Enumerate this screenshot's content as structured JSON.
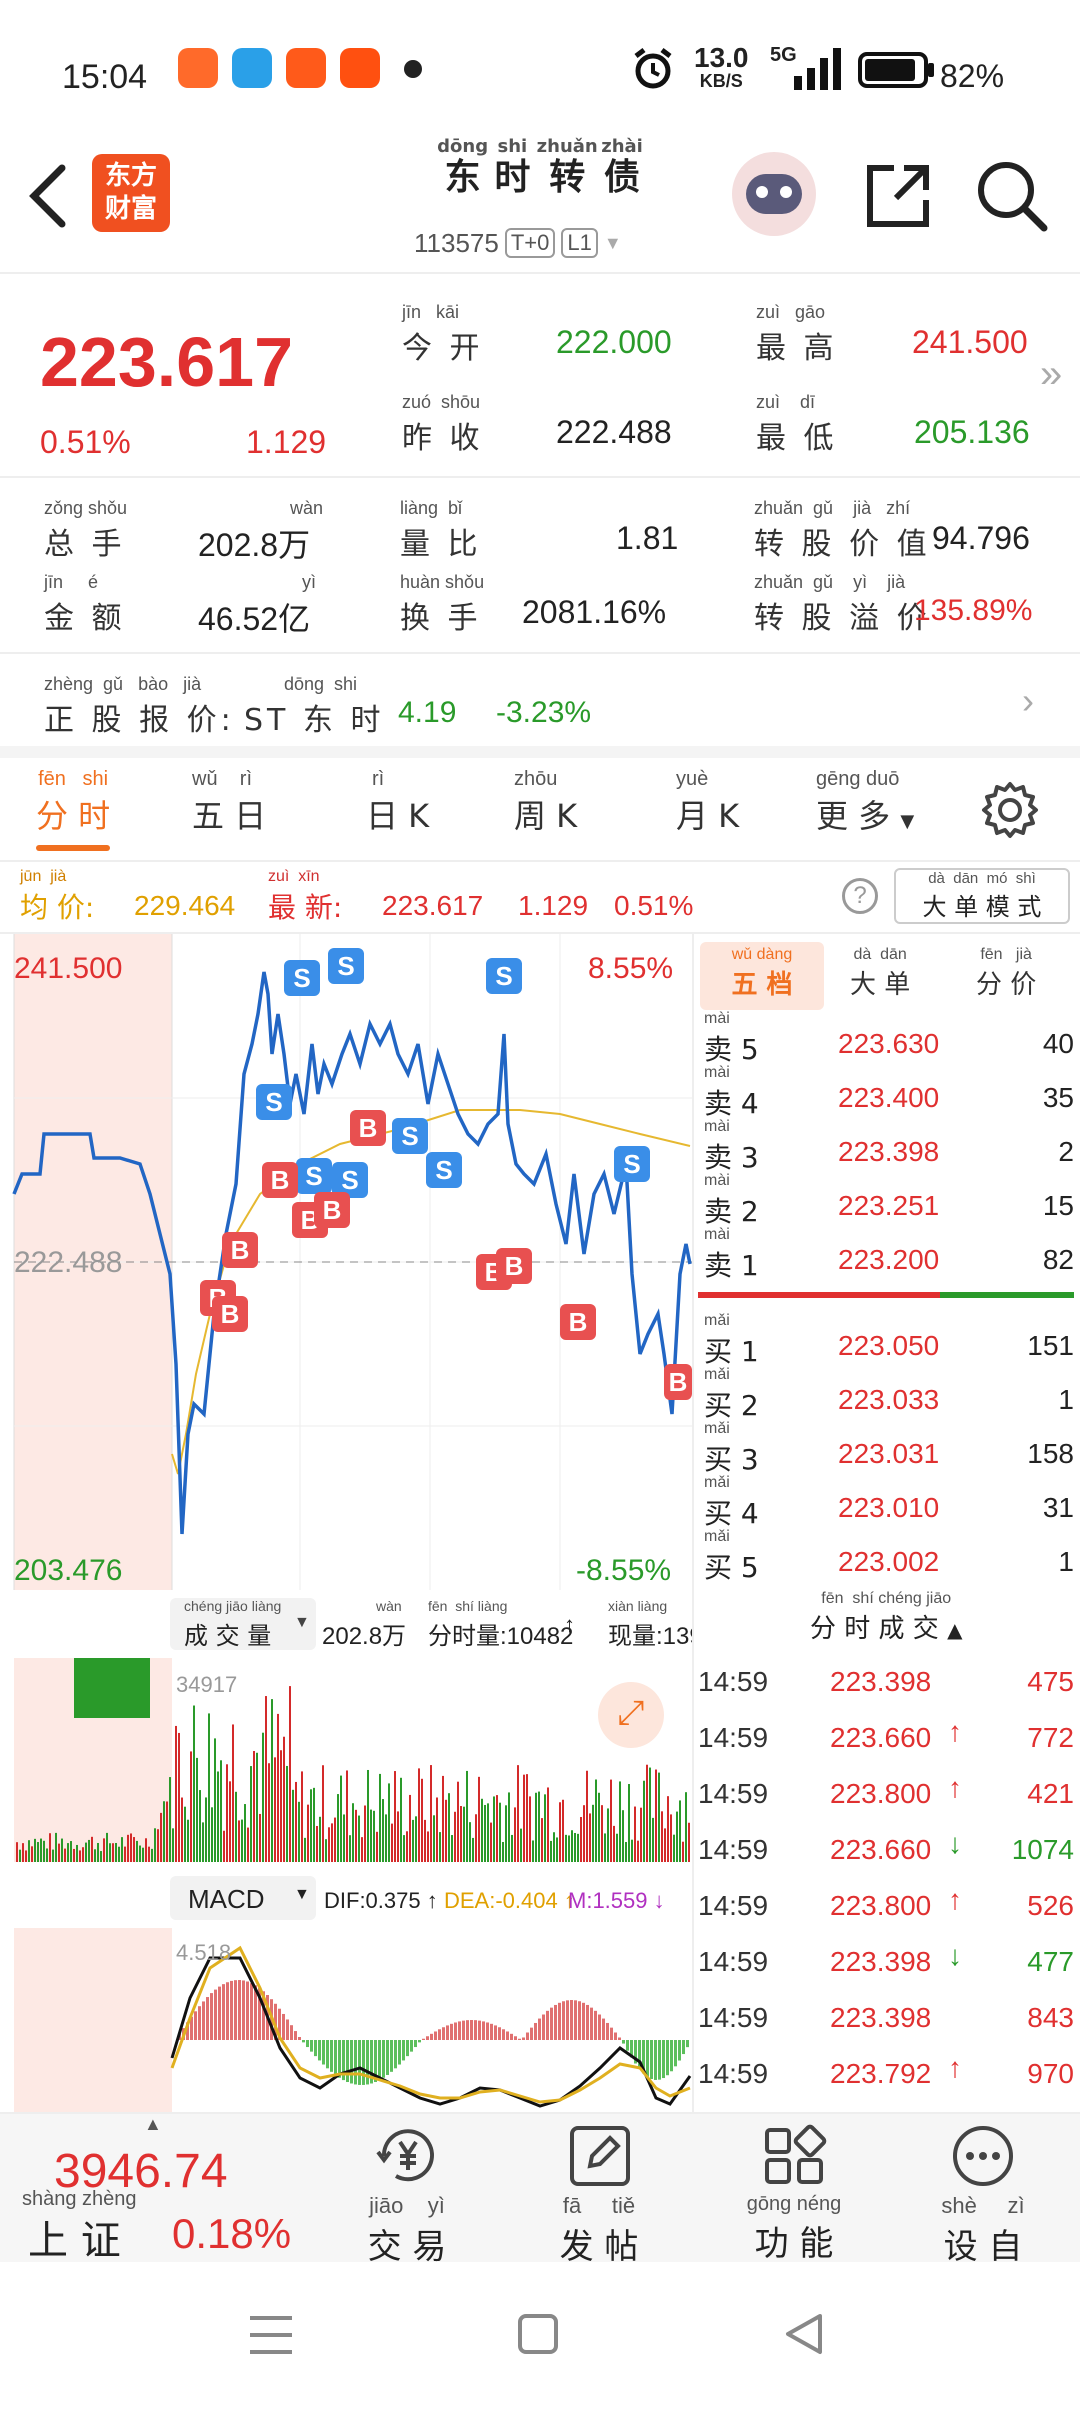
{
  "status_bar": {
    "time": "15:04",
    "speed": "13.0",
    "speed_unit": "KB/S",
    "net": "5G",
    "battery": "82%"
  },
  "header": {
    "logo_line1": "东方",
    "logo_line2": "财富",
    "title_chars": [
      {
        "c": "东",
        "py": "dōng"
      },
      {
        "c": "时",
        "py": "shi"
      },
      {
        "c": "转",
        "py": "zhuǎn"
      },
      {
        "c": "债",
        "py": "zhài"
      }
    ],
    "code": "113575",
    "tag1": "T+0",
    "tag2": "L1"
  },
  "quote": {
    "price": "223.617",
    "change_pct": "0.51%",
    "change": "1.129",
    "open_label": "今 开",
    "open_py": "jīn   kāi",
    "open": "222.000",
    "prev_label": "昨 收",
    "prev_py": "zuó  shōu",
    "prev": "222.488",
    "high_label": "最 高",
    "high_py": "zuì   gāo",
    "high": "241.500",
    "low_label": "最 低",
    "low_py": "zuì    dī",
    "low": "205.136"
  },
  "stats": {
    "vol_label": "总 手",
    "vol_py": "zǒng shǒu",
    "vol": "202.8万",
    "vol_unit_py": "wàn",
    "ratio_label": "量 比",
    "ratio_py": "liàng  bǐ",
    "ratio": "1.81",
    "conv_label": "转 股 价 值",
    "conv_py": "zhuǎn  gǔ    jià   zhí",
    "conv": "94.796",
    "amt_label": "金 额",
    "amt_py": "jīn     é",
    "amt": "46.52亿",
    "amt_unit_py": "yì",
    "turn_label": "换 手",
    "turn_py": "huàn shǒu",
    "turn": "2081.16%",
    "prem_label": "转 股 溢 价",
    "prem_py": "zhuǎn  gǔ    yì    jià",
    "prem": "135.89%"
  },
  "stock_row": {
    "label": "正 股 报 价:",
    "label_py": "zhèng  gǔ   bào   jià",
    "name": "ST 东 时",
    "name_py": "dōng  shi",
    "price": "4.19",
    "pct": "-3.23%"
  },
  "tabs": [
    {
      "label": "分 时",
      "py": "fēn   shi",
      "active": true
    },
    {
      "label": "五 日",
      "py": "wǔ    rì",
      "active": false
    },
    {
      "label": "日 K",
      "py": "rì",
      "active": false
    },
    {
      "label": "周 K",
      "py": "zhōu",
      "active": false
    },
    {
      "label": "月 K",
      "py": "yuè",
      "active": false
    },
    {
      "label": "更 多",
      "py": "gēng duō",
      "active": false
    }
  ],
  "avg_row": {
    "avg_label": "均 价:",
    "avg_py": "jūn  jià",
    "avg": "229.464",
    "new_label": "最 新:",
    "new_py": "zuì  xīn",
    "new": "223.617",
    "chg": "1.129",
    "pct": "0.51%",
    "mode": "大 单 模 式",
    "mode_py": "dà  dān  mó  shì"
  },
  "chart_labels": {
    "top_left": "241.500",
    "top_right": "8.55%",
    "mid_left": "222.488",
    "bot_left": "203.476",
    "bot_right": "-8.55%"
  },
  "vol_bar": {
    "label": "成 交 量",
    "label_py": "chéng jiāo liàng",
    "total": "202.8万",
    "total_py": "wàn",
    "minute": "分时量:10482",
    "minute_py": "fēn  shí liàng",
    "now": "现量:139",
    "now_py": "xiàn liàng",
    "max": "34917"
  },
  "macd_bar": {
    "label": "MACD",
    "dif": "DIF:0.375",
    "dea": "DEA:-0.404",
    "m": "M:1.559",
    "max": "4.518"
  },
  "book": {
    "tabs": [
      {
        "label": "五 档",
        "py": "wǔ dàng"
      },
      {
        "label": "大 单",
        "py": "dà  dān"
      },
      {
        "label": "分 价",
        "py": "fēn   jià"
      }
    ],
    "asks": [
      {
        "label": "卖 5",
        "price": "223.630",
        "qty": "40"
      },
      {
        "label": "卖 4",
        "price": "223.400",
        "qty": "35"
      },
      {
        "label": "卖 3",
        "price": "223.398",
        "qty": "2"
      },
      {
        "label": "卖 2",
        "price": "223.251",
        "qty": "15"
      },
      {
        "label": "卖 1",
        "price": "223.200",
        "qty": "82"
      }
    ],
    "bids": [
      {
        "label": "买 1",
        "price": "223.050",
        "qty": "151"
      },
      {
        "label": "买 2",
        "price": "223.033",
        "qty": "1"
      },
      {
        "label": "买 3",
        "price": "223.031",
        "qty": "158"
      },
      {
        "label": "买 4",
        "price": "223.010",
        "qty": "31"
      },
      {
        "label": "买 5",
        "price": "223.002",
        "qty": "1"
      }
    ],
    "sell_py": "mài",
    "buy_py": "mǎi"
  },
  "ticks_header": {
    "label": "分 时 成 交",
    "py": "fēn  shí chéng jiāo"
  },
  "ticks": [
    {
      "time": "14:59",
      "price": "223.398",
      "arrow": "",
      "qty": "475",
      "color": "red"
    },
    {
      "time": "14:59",
      "price": "223.660",
      "arrow": "↑",
      "qty": "772",
      "color": "red"
    },
    {
      "time": "14:59",
      "price": "223.800",
      "arrow": "↑",
      "qty": "421",
      "color": "red"
    },
    {
      "time": "14:59",
      "price": "223.660",
      "arrow": "↓",
      "qty": "1074",
      "color": "green"
    },
    {
      "time": "14:59",
      "price": "223.800",
      "arrow": "↑",
      "qty": "526",
      "color": "red"
    },
    {
      "time": "14:59",
      "price": "223.398",
      "arrow": "↓",
      "qty": "477",
      "color": "green"
    },
    {
      "time": "14:59",
      "price": "223.398",
      "arrow": "",
      "qty": "843",
      "color": "red"
    },
    {
      "time": "14:59",
      "price": "223.792",
      "arrow": "↑",
      "qty": "970",
      "color": "red"
    }
  ],
  "bottom": {
    "index_value": "3946.74",
    "index_name": "上 证",
    "index_py": "shàng zhèng",
    "index_pct": "0.18%",
    "items": [
      {
        "label": "交 易",
        "py": "jiāo    yì"
      },
      {
        "label": "发 帖",
        "py": "fā     tiě"
      },
      {
        "label": "功 能",
        "py": "gōng néng"
      },
      {
        "label": "设 自",
        "py": "shè     zì"
      }
    ]
  }
}
